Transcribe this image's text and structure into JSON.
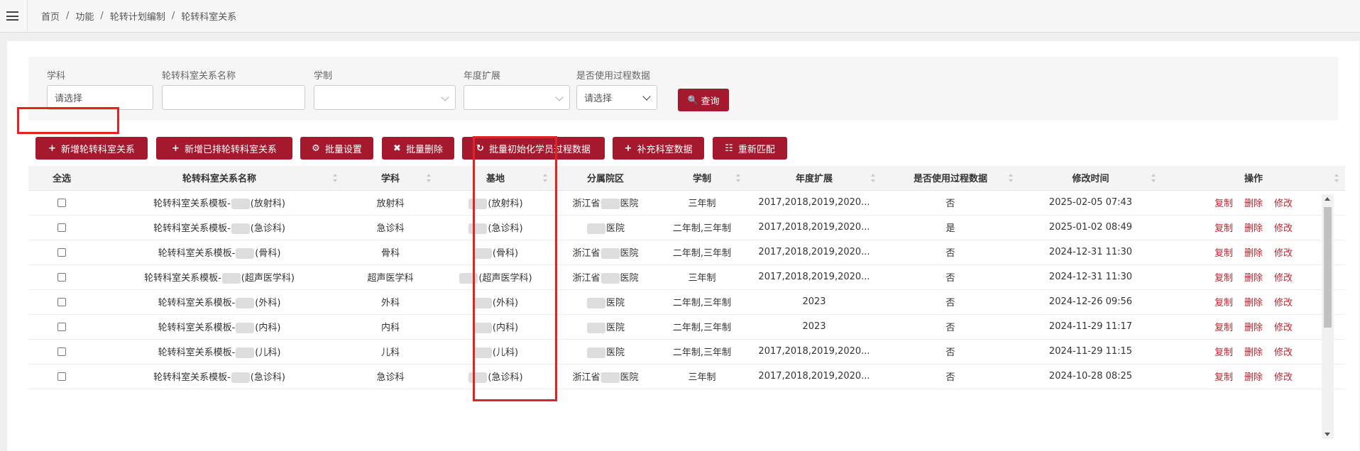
{
  "breadcrumb": [
    "首页",
    "功能",
    "轮转计划编制",
    "轮转科室关系"
  ],
  "filters": {
    "subject": {
      "label": "学科",
      "value": "请选择"
    },
    "relation_name": {
      "label": "轮转科室关系名称",
      "value": ""
    },
    "program_length": {
      "label": "学制",
      "value": ""
    },
    "year_extension": {
      "label": "年度扩展",
      "value": ""
    },
    "use_process_data": {
      "label": "是否使用过程数据",
      "value": "请选择"
    },
    "query_button": "查询"
  },
  "toolbar": {
    "add_relation": "新增轮转科室关系",
    "add_scheduled": "新增已排轮转科室关系",
    "batch_settings": "批量设置",
    "batch_delete": "批量删除",
    "batch_init": "批量初始化学员过程数据",
    "supplement": "补充科室数据",
    "rematch": "重新匹配"
  },
  "table": {
    "headers": {
      "select_all": "全选",
      "name": "轮转科室关系名称",
      "subject": "学科",
      "base": "基地",
      "branch": "分属院区",
      "program": "学制",
      "year_ext": "年度扩展",
      "use_process": "是否使用过程数据",
      "modified": "修改时间",
      "actions": "操作"
    },
    "actions": {
      "copy": "复制",
      "delete": "删除",
      "edit": "修改"
    },
    "rows": [
      {
        "name_prefix": "轮转科室关系模板-",
        "name_suffix": "(放射科)",
        "subject": "放射科",
        "base_suffix": "(放射科)",
        "branch_prefix": "浙江省",
        "branch_suffix": "医院",
        "program": "三年制",
        "year_ext": "2017,2018,2019,2020...",
        "use_process": "否",
        "modified": "2025-02-05 07:43"
      },
      {
        "name_prefix": "轮转科室关系模板-",
        "name_suffix": "(急诊科)",
        "subject": "急诊科",
        "base_suffix": "(急诊科)",
        "branch_prefix": "",
        "branch_suffix": "医院",
        "program": "二年制,三年制",
        "year_ext": "2017,2018,2019,2020...",
        "use_process": "是",
        "modified": "2025-01-02 08:49"
      },
      {
        "name_prefix": "轮转科室关系模板-",
        "name_suffix": "(骨科)",
        "subject": "骨科",
        "base_suffix": "(骨科)",
        "branch_prefix": "浙江省",
        "branch_suffix": "医院",
        "program": "二年制,三年制",
        "year_ext": "2017,2018,2019,2020...",
        "use_process": "否",
        "modified": "2024-12-31 11:30"
      },
      {
        "name_prefix": "轮转科室关系模板-",
        "name_suffix": "(超声医学科)",
        "subject": "超声医学科",
        "base_suffix": "(超声医学科)",
        "branch_prefix": "浙江省",
        "branch_suffix": "医院",
        "program": "三年制",
        "year_ext": "2017,2018,2019,2020...",
        "use_process": "否",
        "modified": "2024-12-31 11:30"
      },
      {
        "name_prefix": "轮转科室关系模板-",
        "name_suffix": "(外科)",
        "subject": "外科",
        "base_suffix": "(外科)",
        "branch_prefix": "",
        "branch_suffix": "医院",
        "program": "二年制,三年制",
        "year_ext": "2023",
        "use_process": "否",
        "modified": "2024-12-26 09:56"
      },
      {
        "name_prefix": "轮转科室关系模板-",
        "name_suffix": "(内科)",
        "subject": "内科",
        "base_suffix": "(内科)",
        "branch_prefix": "",
        "branch_suffix": "医院",
        "program": "二年制,三年制",
        "year_ext": "2023",
        "use_process": "否",
        "modified": "2024-11-29 11:17"
      },
      {
        "name_prefix": "轮转科室关系模板-",
        "name_suffix": "(儿科)",
        "subject": "儿科",
        "base_suffix": "(儿科)",
        "branch_prefix": "",
        "branch_suffix": "医院",
        "program": "二年制,三年制",
        "year_ext": "2017,2018,2019,2020...",
        "use_process": "否",
        "modified": "2024-11-29 11:15"
      },
      {
        "name_prefix": "轮转科室关系模板-",
        "name_suffix": "(急诊科)",
        "subject": "急诊科",
        "base_suffix": "(急诊科)",
        "branch_prefix": "浙江省",
        "branch_suffix": "医院",
        "program": "三年制",
        "year_ext": "2017,2018,2019,2020...",
        "use_process": "否",
        "modified": "2024-10-28 08:25"
      }
    ]
  },
  "colors": {
    "accent": "#a5192e",
    "highlight_outline": "#e02424",
    "action_link": "#c0242f"
  }
}
